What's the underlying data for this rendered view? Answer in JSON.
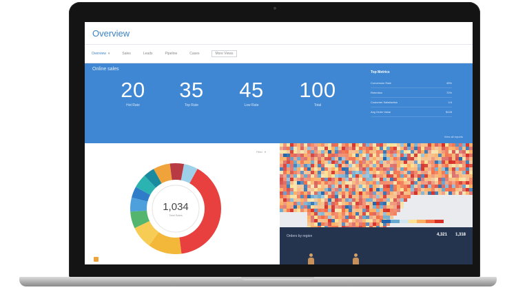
{
  "app": {
    "title": "Overview"
  },
  "tabs": [
    {
      "label": "Overview",
      "active": true
    },
    {
      "label": "Sales"
    },
    {
      "label": "Leads"
    },
    {
      "label": "Pipeline"
    },
    {
      "label": "Cases"
    },
    {
      "label": "More Views",
      "boxed": true
    }
  ],
  "kpis": {
    "section_label": "Online sales",
    "items": [
      {
        "value": "20",
        "caption": "Hot Rate"
      },
      {
        "value": "35",
        "caption": "Top Rate"
      },
      {
        "value": "45",
        "caption": "Low Rate"
      },
      {
        "value": "100",
        "caption": "Total"
      }
    ],
    "table": {
      "header": "Top Metrics",
      "rows": [
        {
          "label": "Conversion Rate",
          "value": "45%"
        },
        {
          "label": "Retention",
          "value": "72%"
        },
        {
          "label": "Customer Satisfaction",
          "value": "4.6"
        },
        {
          "label": "Avg Order Value",
          "value": "$128"
        }
      ]
    },
    "link_text": "View all reports"
  },
  "donut": {
    "total": "1,034",
    "sublabel": "Total Sales",
    "control_label": "Filter",
    "segments": [
      {
        "value": 40,
        "color": "#e8403f"
      },
      {
        "value": 12,
        "color": "#f3b83a"
      },
      {
        "value": 8,
        "color": "#f6cc55"
      },
      {
        "value": 6,
        "color": "#53b56e"
      },
      {
        "value": 5,
        "color": "#4ea0dd"
      },
      {
        "value": 4,
        "color": "#2f7cc9"
      },
      {
        "value": 5,
        "color": "#2bb3b1"
      },
      {
        "value": 4,
        "color": "#1a8a9e"
      },
      {
        "value": 6,
        "color": "#f0a33a"
      },
      {
        "value": 5,
        "color": "#b83b43"
      },
      {
        "value": 5,
        "color": "#9fd0ea"
      }
    ]
  },
  "map": {
    "legend_colors": [
      "#2166ac",
      "#67a9cf",
      "#d1e5f0",
      "#fee090",
      "#fdae61",
      "#f46d43",
      "#d73027"
    ]
  },
  "bottom_panel": {
    "title": "Orders by region",
    "stats": [
      "4,321",
      "1,318"
    ]
  }
}
